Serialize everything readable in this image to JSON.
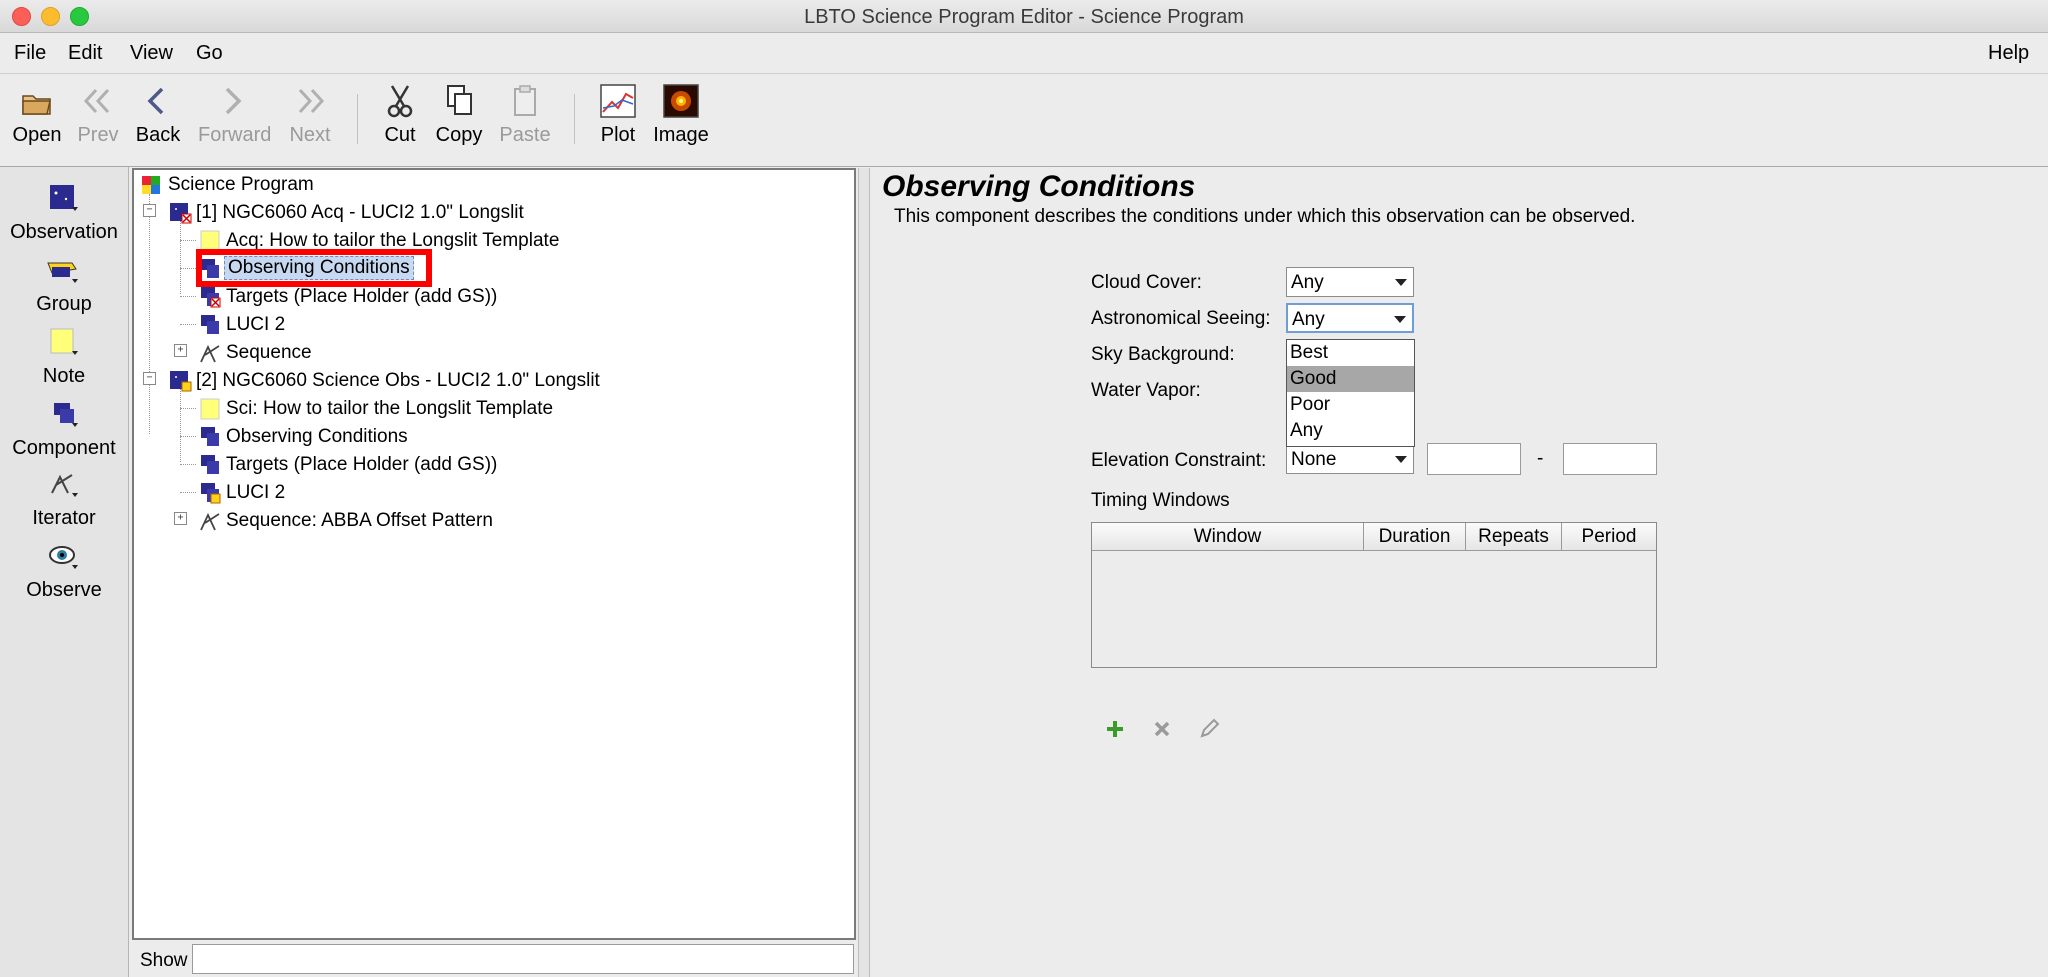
{
  "window": {
    "title": "LBTO Science Program Editor - Science Program"
  },
  "menubar": {
    "items": [
      "File",
      "Edit",
      "View",
      "Go"
    ],
    "help": "Help"
  },
  "toolbar": {
    "open": "Open",
    "prev": "Prev",
    "back": "Back",
    "forward": "Forward",
    "next": "Next",
    "cut": "Cut",
    "copy": "Copy",
    "paste": "Paste",
    "plot": "Plot",
    "image": "Image"
  },
  "palette": {
    "items": [
      "Observation",
      "Group",
      "Note",
      "Component",
      "Iterator",
      "Observe"
    ]
  },
  "tree": {
    "root": "Science Program",
    "obs1": {
      "label": "[1] NGC6060 Acq - LUCI2 1.0\" Longslit",
      "children": [
        "Acq: How to tailor the Longslit Template",
        "Observing Conditions",
        "Targets (Place Holder (add GS))",
        "LUCI 2",
        "Sequence"
      ]
    },
    "obs2": {
      "label": "[2] NGC6060 Science Obs  - LUCI2 1.0\" Longslit",
      "children": [
        "Sci: How to tailor the Longslit Template",
        "Observing Conditions",
        "Targets (Place Holder (add GS))",
        "LUCI 2",
        "Sequence: ABBA Offset Pattern"
      ]
    },
    "selected": "Observing Conditions"
  },
  "show": {
    "label": "Show",
    "value": ""
  },
  "editor": {
    "title": "Observing Conditions",
    "description": "This component describes the conditions under which this observation can be observed.",
    "cloud_cover": {
      "label": "Cloud Cover:",
      "value": "Any"
    },
    "seeing": {
      "label": "Astronomical Seeing:",
      "value": "Any",
      "options": [
        "Best",
        "Good",
        "Poor",
        "Any"
      ],
      "highlighted": "Good"
    },
    "sky_background": {
      "label": "Sky Background:"
    },
    "water_vapor": {
      "label": "Water Vapor:"
    },
    "elevation": {
      "label": "Elevation Constraint:",
      "value": "None",
      "min": "",
      "max": "",
      "dash": "-"
    },
    "timing": {
      "label": "Timing Windows",
      "columns": [
        "Window",
        "Duration",
        "Repeats",
        "Period"
      ],
      "rows": []
    }
  },
  "colors": {
    "selection": "#c6d9f1",
    "highlight_box": "#ff0000",
    "dropdown_selected": "#a7a7a7"
  }
}
